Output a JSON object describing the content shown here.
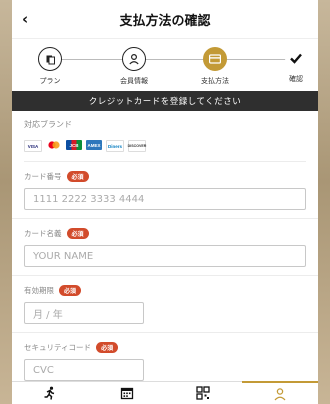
{
  "header": {
    "title": "支払方法の確認"
  },
  "steps": [
    {
      "label": "プラン",
      "state": "done-outline"
    },
    {
      "label": "会員情報",
      "state": "outline"
    },
    {
      "label": "支払方法",
      "state": "active"
    },
    {
      "label": "確認",
      "state": "outline"
    }
  ],
  "banner": "クレジットカードを登録してください",
  "brands": {
    "title": "対応ブランド",
    "cards": [
      "VISA",
      "MC",
      "JCB",
      "AMEX",
      "Diners",
      "DISCOVER"
    ]
  },
  "fields": {
    "card_number": {
      "label": "カード番号",
      "required": "必須",
      "placeholder": "1111 2222 3333 4444"
    },
    "card_name": {
      "label": "カード名義",
      "required": "必須",
      "placeholder": "YOUR NAME"
    },
    "expiry": {
      "label": "有効期限",
      "required": "必須",
      "placeholder": "月 / 年"
    },
    "cvc": {
      "label": "セキュリティコード",
      "required": "必須",
      "placeholder": "CVC"
    }
  },
  "colors": {
    "accent": "#c39a36",
    "required_badge": "#d24b2b",
    "banner_bg": "#2f2f2f"
  },
  "nav": {
    "items": [
      "run-icon",
      "calendar-icon",
      "qr-icon",
      "user-icon"
    ],
    "active": "user-icon"
  }
}
